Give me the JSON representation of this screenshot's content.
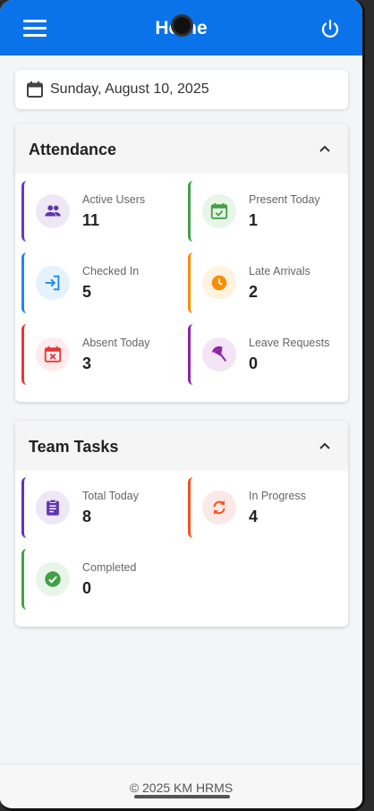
{
  "header": {
    "title": "Home"
  },
  "date": {
    "text": "Sunday, August 10, 2025"
  },
  "attendance": {
    "title": "Attendance",
    "tiles": [
      {
        "label": "Active Users",
        "value": "11",
        "color": "#673ab7",
        "icon": "users-icon"
      },
      {
        "label": "Present Today",
        "value": "1",
        "color": "#43a047",
        "icon": "calendar-check-icon"
      },
      {
        "label": "Checked In",
        "value": "5",
        "color": "#1e88e5",
        "icon": "login-icon"
      },
      {
        "label": "Late Arrivals",
        "value": "2",
        "color": "#fb8c00",
        "icon": "clock-icon"
      },
      {
        "label": "Absent Today",
        "value": "3",
        "color": "#e53935",
        "icon": "calendar-x-icon"
      },
      {
        "label": "Leave Requests",
        "value": "0",
        "color": "#8e24aa",
        "icon": "beach-umbrella-icon"
      }
    ]
  },
  "tasks": {
    "title": "Team Tasks",
    "tiles": [
      {
        "label": "Total Today",
        "value": "8",
        "color": "#5e35b1",
        "icon": "clipboard-icon"
      },
      {
        "label": "In Progress",
        "value": "4",
        "color": "#f4511e",
        "icon": "refresh-icon"
      },
      {
        "label": "Completed",
        "value": "0",
        "color": "#43a047",
        "icon": "check-circle-icon"
      }
    ]
  },
  "footer": {
    "text": "© 2025 KM HRMS"
  }
}
